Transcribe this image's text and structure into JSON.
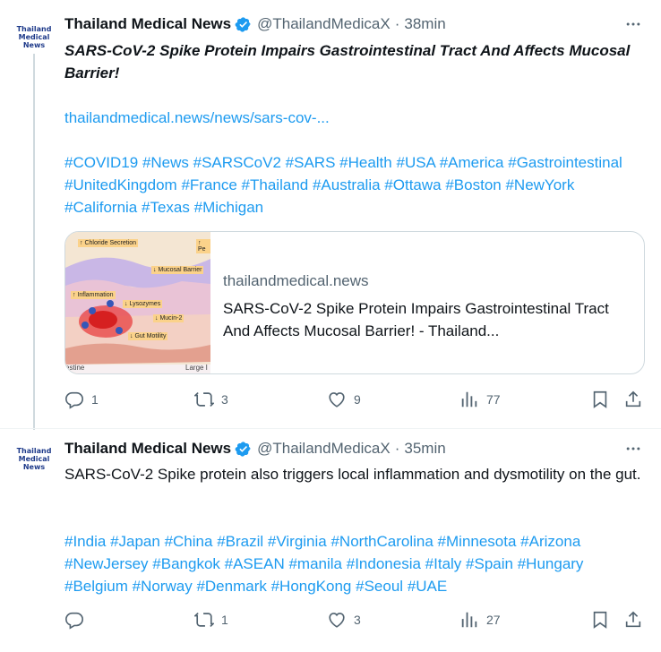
{
  "tweets": [
    {
      "author": {
        "name": "Thailand Medical News",
        "handle": "@ThailandMedicaX",
        "avatar_text": [
          "Thailand",
          "Medical",
          "News"
        ]
      },
      "dot": "·",
      "time": "38min",
      "title": "SARS-CoV-2 Spike Protein Impairs Gastrointestinal Tract And Affects Mucosal Barrier!",
      "link": "thailandmedical.news/news/sars-cov-...",
      "hashtags": [
        "#COVID19",
        "#News",
        "#SARSCoV2",
        "#SARS",
        "#Health",
        "#USA",
        "#America",
        "#Gastrointestinal",
        "#UnitedKingdom",
        "#France",
        "#Thailand",
        "#Australia",
        "#Ottawa",
        "#Boston",
        "#NewYork",
        "#California",
        "#Texas",
        "#Michigan"
      ],
      "card": {
        "domain": "thailandmedical.news",
        "title": "SARS-CoV-2 Spike Protein Impairs Gastrointestinal Tract And Affects Mucosal Barrier! - Thailand...",
        "image_labels": [
          "↑ Chloride Secretion",
          "↑ Pe",
          "↓ Mucosal Barrier",
          "↑ Inflammation",
          "↓ Lysozymes",
          "↓ Mucin-2",
          "↓ Gut Motility",
          "estine",
          "Large I"
        ]
      },
      "actions": {
        "replies": "1",
        "reposts": "3",
        "likes": "9",
        "views": "77"
      }
    },
    {
      "author": {
        "name": "Thailand Medical News",
        "handle": "@ThailandMedicaX",
        "avatar_text": [
          "Thailand",
          "Medical",
          "News"
        ]
      },
      "dot": "·",
      "time": "35min",
      "text": "SARS-CoV-2 Spike protein also triggers local inflammation and dysmotility on the gut.",
      "hashtags": [
        "#India",
        "#Japan",
        "#China",
        "#Brazil",
        "#Virginia",
        "#NorthCarolina",
        "#Minnesota",
        "#Arizona",
        "#NewJersey",
        "#Bangkok",
        "#ASEAN",
        "#manila",
        "#Indonesia",
        "#Italy",
        "#Spain",
        "#Hungary",
        "#Belgium",
        "#Norway",
        "#Denmark",
        "#HongKong",
        "#Seoul",
        "#UAE"
      ],
      "actions": {
        "replies": "",
        "reposts": "1",
        "likes": "3",
        "views": "27"
      }
    }
  ],
  "colors": {
    "accent": "#1d9bf0",
    "muted": "#536471",
    "text": "#0f1419",
    "border": "#cfd9de"
  },
  "icons": [
    "verified-badge-icon",
    "more-icon",
    "reply-icon",
    "repost-icon",
    "like-icon",
    "views-icon",
    "bookmark-icon",
    "share-icon"
  ]
}
